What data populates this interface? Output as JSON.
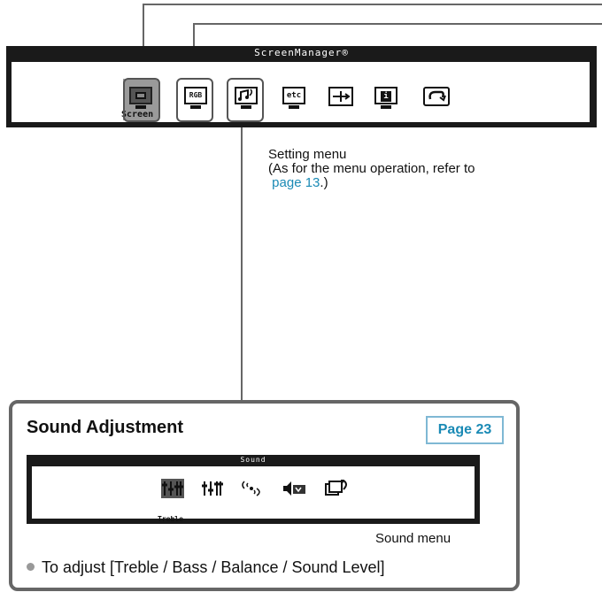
{
  "screenmanager": {
    "title": "ScreenManager®",
    "icons": [
      {
        "name": "screen",
        "label": "Screen",
        "selected": true
      },
      {
        "name": "color",
        "text": "RGB"
      },
      {
        "name": "sound"
      },
      {
        "name": "others",
        "text": "etc"
      },
      {
        "name": "power"
      },
      {
        "name": "information",
        "text": "i"
      },
      {
        "name": "language"
      }
    ]
  },
  "setting_menu": {
    "line1": "Setting menu",
    "line2": "(As for the menu operation, refer to",
    "link": "page 13",
    "suffix": ".)"
  },
  "sound_section": {
    "title": "Sound Adjustment",
    "page_button": "Page 23",
    "menu_title": "Sound",
    "selected_label": "Treble",
    "menu_caption": "Sound menu",
    "bullet": "To adjust [Treble / Bass / Balance / Sound Level]"
  }
}
